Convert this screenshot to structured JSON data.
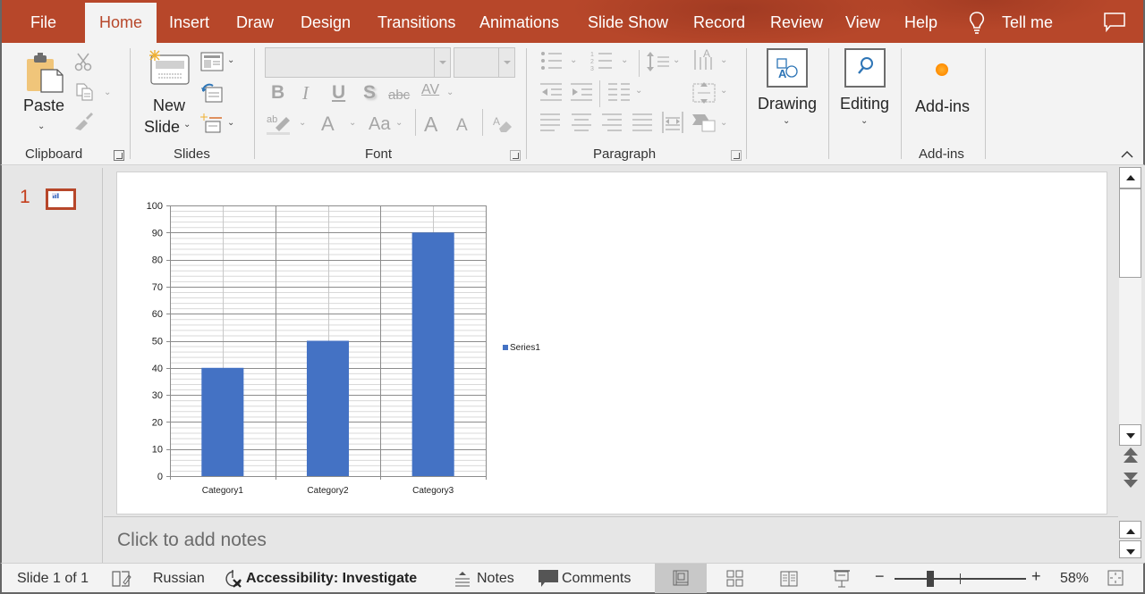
{
  "tabs": [
    {
      "label": "File",
      "active": false
    },
    {
      "label": "Home",
      "active": true
    },
    {
      "label": "Insert",
      "active": false
    },
    {
      "label": "Draw",
      "active": false
    },
    {
      "label": "Design",
      "active": false
    },
    {
      "label": "Transitions",
      "active": false
    },
    {
      "label": "Animations",
      "active": false
    },
    {
      "label": "Slide Show",
      "active": false
    },
    {
      "label": "Record",
      "active": false
    },
    {
      "label": "Review",
      "active": false
    },
    {
      "label": "View",
      "active": false
    },
    {
      "label": "Help",
      "active": false
    }
  ],
  "tell_me": "Tell me",
  "ribbon": {
    "clipboard": {
      "label": "Clipboard",
      "paste": "Paste"
    },
    "slides": {
      "label": "Slides",
      "new_slide_line1": "New",
      "new_slide_line2": "Slide"
    },
    "font": {
      "label": "Font",
      "font_name": "",
      "font_size": "",
      "bold": "B",
      "italic": "I",
      "underline": "U",
      "shadow": "S",
      "strike": "abc",
      "spacing": "AV",
      "font_color": "A",
      "change_case": "Aa",
      "grow": "A",
      "shrink": "A"
    },
    "paragraph": {
      "label": "Paragraph"
    },
    "drawing": {
      "label": "Drawing"
    },
    "editing": {
      "label": "Editing"
    },
    "addins": {
      "label": "Add-ins",
      "button": "Add-ins"
    }
  },
  "thumbnails": [
    {
      "number": "1",
      "selected": true
    }
  ],
  "notes_placeholder": "Click to add notes",
  "status": {
    "slide": "Slide 1 of 1",
    "language": "Russian",
    "accessibility": "Accessibility: Investigate",
    "notes": "Notes",
    "comments": "Comments",
    "zoom": "58%",
    "zoom_level_percent": 58
  },
  "colors": {
    "accent": "#b7472a",
    "bar": "#4472c4"
  },
  "chart_data": {
    "type": "bar",
    "title": "",
    "categories": [
      "Category1",
      "Category2",
      "Category3"
    ],
    "series": [
      {
        "name": "Series1",
        "values": [
          40,
          50,
          90
        ]
      }
    ],
    "xlabel": "",
    "ylabel": "",
    "ylim": [
      0,
      100
    ],
    "yticks": [
      0,
      10,
      20,
      30,
      40,
      50,
      60,
      70,
      80,
      90,
      100
    ],
    "minor_step": 2,
    "grid": true,
    "legend": "right"
  }
}
